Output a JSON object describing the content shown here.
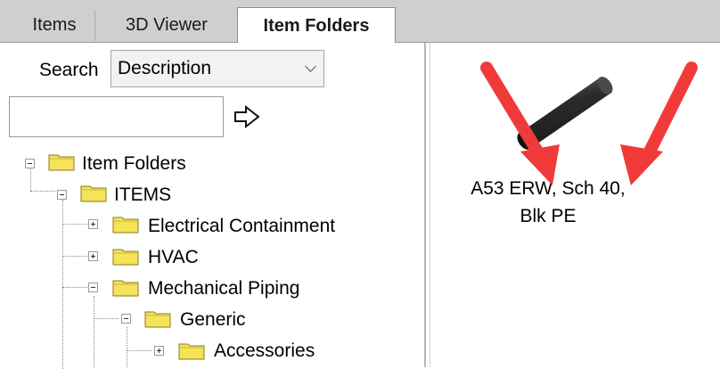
{
  "tabs": [
    {
      "label": "Items",
      "active": false
    },
    {
      "label": "3D Viewer",
      "active": false
    },
    {
      "label": "Item Folders",
      "active": true
    }
  ],
  "search": {
    "label": "Search",
    "field_value": "Description",
    "input_value": ""
  },
  "tree": [
    {
      "label": "Item Folders",
      "level": 0,
      "expanded": true
    },
    {
      "label": "ITEMS",
      "level": 1,
      "expanded": true
    },
    {
      "label": "Electrical Containment",
      "level": 2,
      "expanded": false
    },
    {
      "label": "HVAC",
      "level": 2,
      "expanded": false
    },
    {
      "label": "Mechanical Piping",
      "level": 2,
      "expanded": true
    },
    {
      "label": "Generic",
      "level": 3,
      "expanded": true
    },
    {
      "label": "Accessories",
      "level": 4,
      "expanded": false
    }
  ],
  "item": {
    "caption_line1": "A53 ERW, Sch 40,",
    "caption_line2": "Blk PE"
  },
  "colors": {
    "annotation_arrow": "#f03a3a",
    "folder_fill": "#f5e35a",
    "tab_bar": "#cfcfcf"
  }
}
